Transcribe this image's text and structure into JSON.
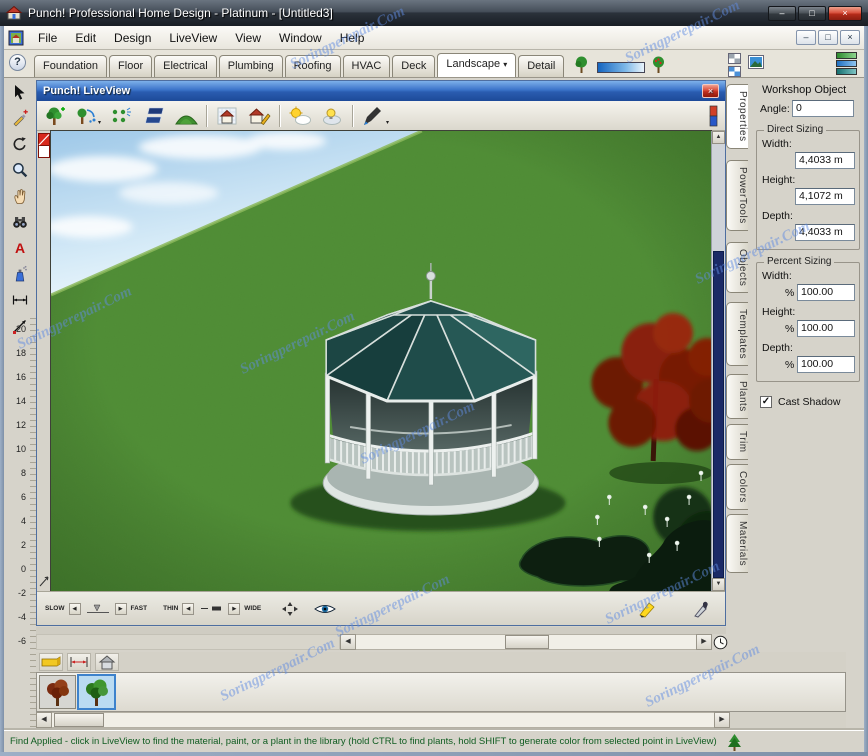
{
  "glyphs": {
    "minimize": "–",
    "maximize": "□",
    "close": "×",
    "help": "?",
    "dropdown": "▾",
    "left": "◀",
    "right": "▶",
    "up": "▲",
    "down": "▼",
    "check": "✓"
  },
  "titlebar": {
    "title": "Punch! Professional Home Design - Platinum - [Untitled3]"
  },
  "menu": {
    "items": [
      "File",
      "Edit",
      "Design",
      "LiveView",
      "View",
      "Window",
      "Help"
    ]
  },
  "design_tabs": {
    "items": [
      {
        "label": "Foundation"
      },
      {
        "label": "Floor"
      },
      {
        "label": "Electrical"
      },
      {
        "label": "Plumbing"
      },
      {
        "label": "Roofing"
      },
      {
        "label": "HVAC"
      },
      {
        "label": "Deck"
      },
      {
        "label": "Landscape",
        "selected": true,
        "dropdown": true
      },
      {
        "label": "Detail"
      }
    ]
  },
  "liveview": {
    "title": "Punch! LiveView",
    "bottom": {
      "slow": "SLOW",
      "fast": "FAST",
      "thin": "THIN",
      "wide": "WIDE"
    }
  },
  "side_tabs": [
    "Properties",
    "PowerTools",
    "Objects",
    "Templates",
    "Plants",
    "Trim",
    "Colors",
    "Materials"
  ],
  "workshop": {
    "title": "Workshop Object",
    "angle_label": "Angle:",
    "angle_value": "0",
    "direct_sizing": {
      "legend": "Direct Sizing",
      "width_label": "Width:",
      "width_value": "4,4033 m",
      "height_label": "Height:",
      "height_value": "4,1072 m",
      "depth_label": "Depth:",
      "depth_value": "4,4033 m"
    },
    "percent_sizing": {
      "legend": "Percent Sizing",
      "percent": "%",
      "width_label": "Width:",
      "width_value": "100.00",
      "height_label": "Height:",
      "height_value": "100.00",
      "depth_label": "Depth:",
      "depth_value": "100.00"
    },
    "cast_shadow_label": "Cast Shadow"
  },
  "ruler": {
    "numbers": [
      "20",
      "18",
      "16",
      "14",
      "12",
      "10",
      "8",
      "6",
      "4",
      "2",
      "0",
      "-2",
      "-4",
      "-6"
    ]
  },
  "status": {
    "text": "Find Applied - click in LiveView to find the material, paint, or a plant in the library (hold CTRL to find plants, hold SHIFT to generate color from selected point in LiveView)"
  },
  "watermark": {
    "text": "Soringperepair.Com"
  },
  "icons": {
    "left_toolbar": [
      "select-arrow",
      "draw-pen",
      "rotate",
      "zoom",
      "pan-hand",
      "binoculars",
      "text-tool",
      "spray-paint",
      "dimension-horizontal",
      "dimension-diagonal"
    ],
    "liveview_toolbar": [
      "plant-tree",
      "tree-water",
      "sprinkler-layout",
      "solar-panel",
      "terrain-hill",
      "house-plan",
      "house-edit",
      "daylight",
      "night-light",
      "color-pen",
      "render-bar"
    ]
  }
}
